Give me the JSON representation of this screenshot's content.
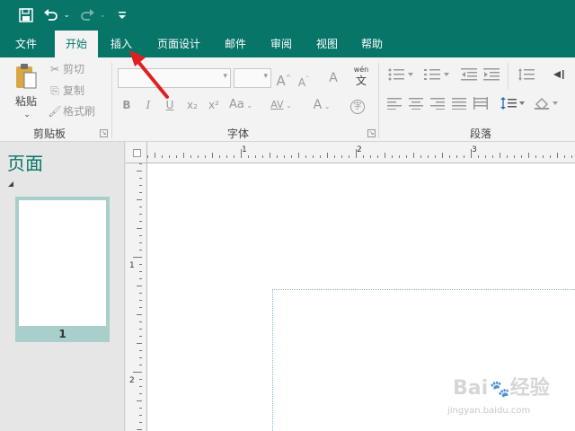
{
  "quick_access": {
    "save_icon": "floppy-disk-icon",
    "undo_icon": "undo-icon",
    "redo_icon": "redo-icon",
    "customize_icon": "customize-toolbar-icon",
    "chevron": "⌄"
  },
  "tabs": [
    {
      "label": "文件",
      "active": false
    },
    {
      "label": "开始",
      "active": true
    },
    {
      "label": "插入",
      "active": false
    },
    {
      "label": "页面设计",
      "active": false
    },
    {
      "label": "邮件",
      "active": false
    },
    {
      "label": "审阅",
      "active": false
    },
    {
      "label": "视图",
      "active": false
    },
    {
      "label": "帮助",
      "active": false
    }
  ],
  "ribbon": {
    "clipboard": {
      "paste_label": "粘贴",
      "cut_label": "剪切",
      "copy_label": "复制",
      "format_painter_label": "格式刷",
      "group_label": "剪贴板"
    },
    "font": {
      "font_name": "",
      "font_size": "",
      "grow_label": "A",
      "shrink_label": "A",
      "clear_label": "A",
      "phonetic_top": "wén",
      "phonetic_bottom": "文",
      "bold": "B",
      "italic": "I",
      "underline": "U",
      "subscript": "x₂",
      "superscript": "x²",
      "change_case": "Aa",
      "spacing": "AV",
      "color": "A",
      "enclose": "字",
      "group_label": "字体"
    },
    "paragraph": {
      "group_label": "段落"
    }
  },
  "pages_pane": {
    "title": "页面",
    "page_number": "1"
  },
  "rulers": {
    "h_numbers": [
      "1",
      "2",
      "3"
    ],
    "v_numbers": [
      "1",
      "2"
    ]
  },
  "watermark": {
    "text": "Bai",
    "text2": "经验",
    "sub": "jingyan.baidu.com"
  },
  "colors": {
    "accent": "#077568",
    "annotation_arrow": "#e02020"
  }
}
